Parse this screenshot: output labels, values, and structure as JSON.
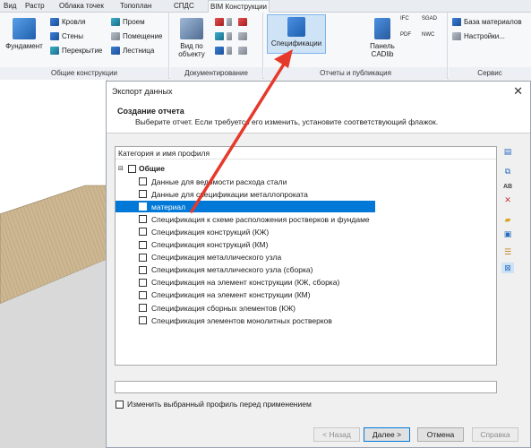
{
  "ribbon_tabs": [
    "Вид",
    "Растр",
    "Облака точек",
    "Топоплан",
    "СПДС",
    "BIM Конструкции"
  ],
  "ribbon": {
    "general": {
      "foundation": "Фундамент",
      "roof": "Кровля",
      "walls": "Стены",
      "slabs": "Перекрытие",
      "opening": "Проем",
      "room": "Помещение",
      "stair": "Лестница",
      "label": "Общие конструкции"
    },
    "docs": {
      "view_by_object": "Вид по объекту",
      "label": "Документирование"
    },
    "reports": {
      "specifications": "Спецификации",
      "cadlib_panel": "Панель CADlib",
      "ifc": "IFC",
      "pdf": "PDF",
      "sgad": "SGAD",
      "nwc": "NWC",
      "label": "Отчеты и публикация"
    },
    "service": {
      "materials_base": "База материалов",
      "settings": "Настройки...",
      "label": "Сервис"
    }
  },
  "dialog": {
    "title": "Экспорт данных",
    "close": "✕",
    "header_title": "Создание отчета",
    "header_sub": "Выберите отчет. Если требуется его изменить, установите соответствующий флажок.",
    "column_header": "Категория и имя профиля",
    "root_label": "Общие",
    "items": [
      "Данные для ведомости расхода стали",
      "Данные для спецификации металлопроката",
      "материал",
      "Спецификация к схеме расположения ростверков и фундаме",
      "Спецификация конструкций (КЖ)",
      "Спецификация конструкций (КМ)",
      "Спецификация металлического узла",
      "Спецификация металлического узла (сборка)",
      "Спецификация на элемент конструкции (КЖ, сборка)",
      "Спецификация на элемент конструкции (КМ)",
      "Спецификация сборных элементов (КЖ)",
      "Спецификация элементов монолитных ростверков"
    ],
    "selected_index": 2,
    "edit_checkbox_label": "Изменить выбранный профиль перед применением",
    "buttons": {
      "back": "< Назад",
      "next": "Далее >",
      "cancel": "Отмена",
      "help": "Справка"
    }
  },
  "colors": {
    "selection": "#0078d7",
    "arrow": "#e5392b",
    "roof_fill": "#cdb792"
  }
}
